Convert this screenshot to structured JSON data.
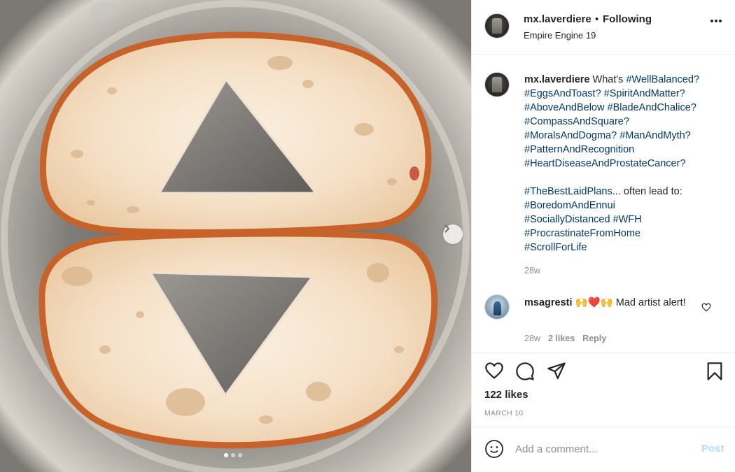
{
  "photo": {
    "alt_subject": "",
    "carousel_dots": 3,
    "active_dot": 0
  },
  "post": {
    "username": "mx.laverdiere",
    "separator": "•",
    "follow_status": "Following",
    "location": "Empire Engine 19"
  },
  "caption": {
    "username": "mx.laverdiere",
    "lead": "What's",
    "first_tag": "#WellBalanced?",
    "tags_1": [
      "#EggsAndToast? #SpiritAndMatter?",
      "#AboveAndBelow #BladeAndChalice?",
      "#CompassAndSquare?",
      "#MoralsAndDogma? #ManAndMyth?",
      "#PatternAndRecognition",
      "#HeartDiseaseAndProstateCancer?"
    ],
    "tag_2a": "#TheBestLaidPlans",
    "text_2": "... often lead to:",
    "tags_2": [
      "#BoredomAndEnnui",
      "#SociallyDistanced #WFH",
      "#ProcrastinateFromHome",
      "#ScrollForLife"
    ],
    "time": "28w"
  },
  "comment": {
    "username": "msagresti",
    "emojis": "🙌❤️🙌",
    "text": "Mad artist alert!",
    "time": "28w",
    "likes": "2 likes",
    "reply": "Reply"
  },
  "engagement": {
    "likes": "122 likes",
    "date": "MARCH 10"
  },
  "add_comment": {
    "placeholder": "Add a comment...",
    "post_label": "Post"
  },
  "colors": {
    "link": "#00376b",
    "muted": "#8e8e8e",
    "post_disabled": "#b2dffc"
  }
}
